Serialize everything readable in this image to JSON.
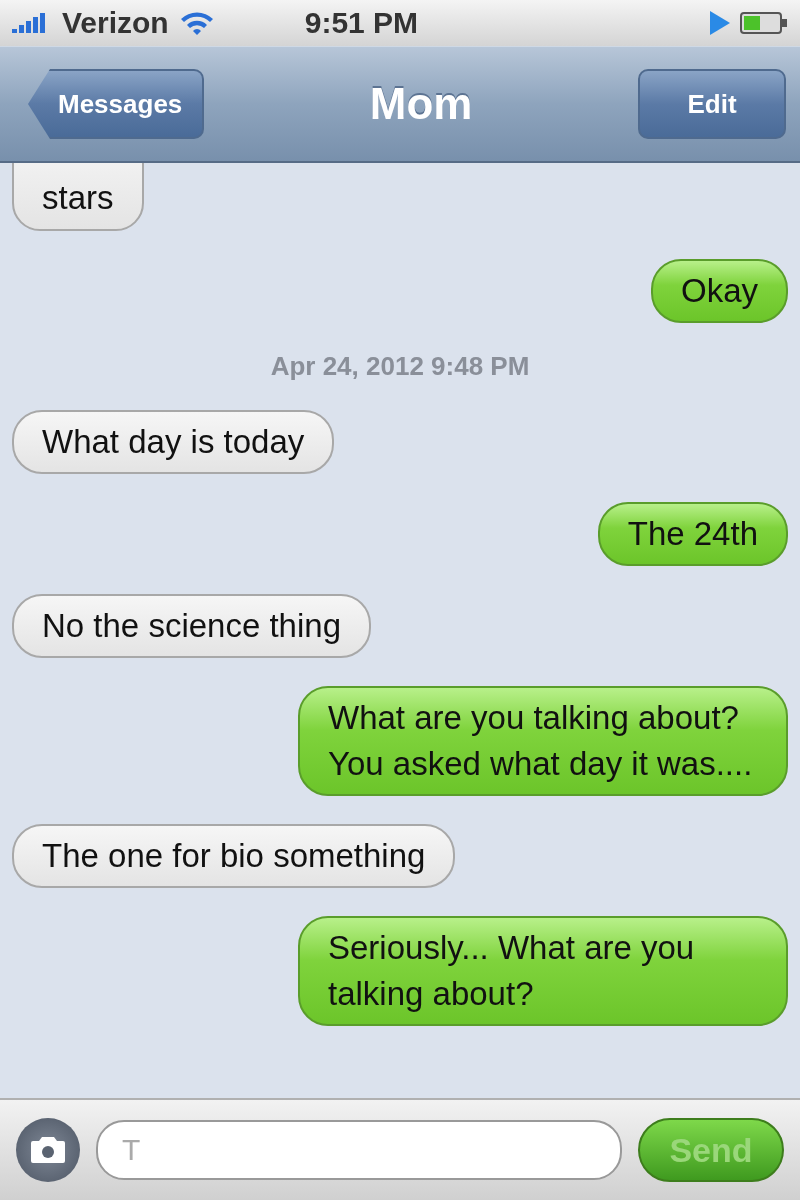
{
  "status_bar": {
    "carrier": "Verizon",
    "time": "9:51 PM"
  },
  "nav_bar": {
    "back_button": "Messages",
    "title": "Mom",
    "edit_button": "Edit"
  },
  "messages": [
    {
      "kind": "received",
      "text": "stars",
      "cut_top": true
    },
    {
      "kind": "sent",
      "text": "Okay"
    },
    {
      "kind": "timestamp",
      "text": "Apr 24, 2012 9:48 PM"
    },
    {
      "kind": "received",
      "text": "What day is today"
    },
    {
      "kind": "sent",
      "text": "The 24th"
    },
    {
      "kind": "received",
      "text": "No the science thing"
    },
    {
      "kind": "sent",
      "text": "What are you talking about? You asked what day it was...."
    },
    {
      "kind": "received",
      "text": "The one for bio something"
    },
    {
      "kind": "sent",
      "text": "Seriously... What are you talking about?"
    }
  ],
  "compose": {
    "placeholder": "T",
    "send_button": {
      "label": "Send",
      "disabled": true
    }
  }
}
